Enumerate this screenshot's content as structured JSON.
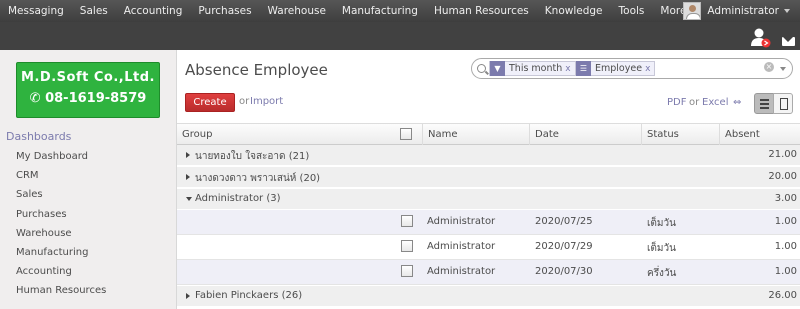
{
  "topmenu": {
    "items": [
      "Messaging",
      "Sales",
      "Accounting",
      "Purchases",
      "Warehouse",
      "Manufacturing",
      "Human Resources",
      "Knowledge",
      "Tools",
      "More"
    ],
    "user": "Administrator"
  },
  "logo": {
    "line1": "M.D.Soft Co.,Ltd.",
    "line2": "08-1619-8579"
  },
  "sidebar": {
    "section": "Dashboards",
    "items": [
      "My Dashboard",
      "CRM",
      "Sales",
      "Purchases",
      "Warehouse",
      "Manufacturing",
      "Accounting",
      "Human Resources"
    ]
  },
  "page": {
    "title": "Absence Employee"
  },
  "search": {
    "facets": [
      {
        "icon": "filter-icon",
        "label": "This month"
      },
      {
        "icon": "group-by-icon",
        "label": "Employee"
      }
    ],
    "clear_glyph": "x"
  },
  "toolbar": {
    "create": "Create",
    "or": "or",
    "import": "Import",
    "pdf": "PDF",
    "or2": "or",
    "excel": "Excel",
    "expand": "⇔"
  },
  "table": {
    "columns": {
      "group": "Group",
      "name": "Name",
      "date": "Date",
      "status": "Status",
      "absent": "Absent"
    },
    "groups": [
      {
        "label": "นายทองใบ ใจสะอาด (21)",
        "total": "21.00",
        "expanded": false
      },
      {
        "label": "นางดวงดาว พราวเสน่ห์ (20)",
        "total": "20.00",
        "expanded": false
      },
      {
        "label": "Administrator (3)",
        "total": "3.00",
        "expanded": true
      },
      {
        "label": "Fabien Pinckaers (26)",
        "total": "26.00",
        "expanded": false
      }
    ],
    "rows": [
      {
        "name": "Administrator",
        "date": "2020/07/25",
        "status": "เต็มวัน",
        "absent": "1.00"
      },
      {
        "name": "Administrator",
        "date": "2020/07/29",
        "status": "เต็มวัน",
        "absent": "1.00"
      },
      {
        "name": "Administrator",
        "date": "2020/07/30",
        "status": "ครึ่งวัน",
        "absent": "1.00"
      }
    ]
  },
  "colors": {
    "accent": "#7c7bad",
    "create_button": "#cf3535",
    "logo_bg": "#2fb33f",
    "topbar": "#4a4a4a"
  }
}
